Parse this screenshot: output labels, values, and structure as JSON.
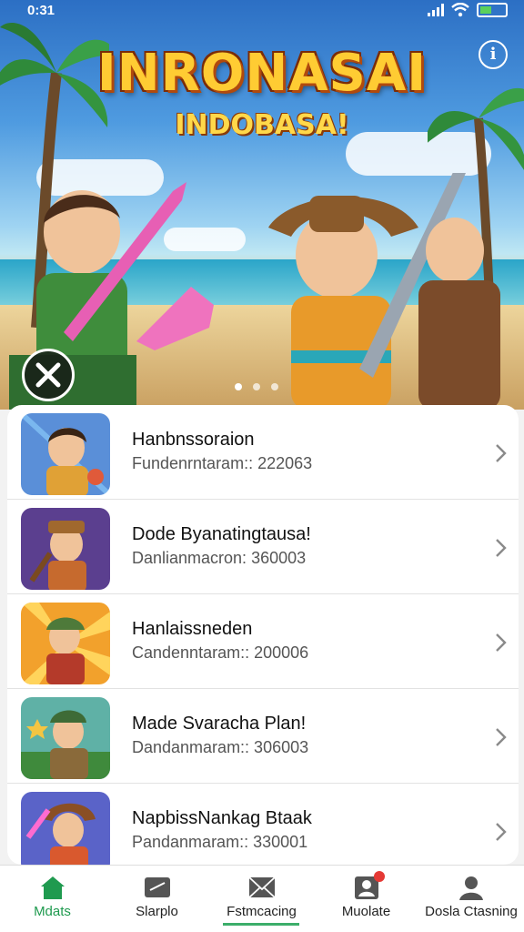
{
  "status_bar": {
    "time": "0:31"
  },
  "hero": {
    "title": "INRONASAI",
    "subtitle": "INDOBASA!"
  },
  "list": [
    {
      "title": "Hanbnssoraion",
      "subtitle": "Fundenrntaram:: 222063"
    },
    {
      "title": "Dode Byanatingtausa!",
      "subtitle": "Danlianmacron: 360003"
    },
    {
      "title": "Hanlaissneden",
      "subtitle": "Candenntaram:: 200006"
    },
    {
      "title": "Made Svaracha Plan!",
      "subtitle": "Dandanmaram:: 306003"
    },
    {
      "title": "NapbissNankag Btaak",
      "subtitle": "Pandanmaram:: 330001"
    }
  ],
  "bottom_nav": [
    {
      "label": "Mdats",
      "icon": "home-icon",
      "active": true
    },
    {
      "label": "Slarplo",
      "icon": "card-icon"
    },
    {
      "label": "Fstmcacing",
      "icon": "mail-icon"
    },
    {
      "label": "Muolate",
      "icon": "profile-card-icon"
    },
    {
      "label": "Dosla Ctasning",
      "icon": "person-icon"
    }
  ],
  "colors": {
    "accent": "#1f9a4f",
    "title": "#ffcc33",
    "badge": "#e53935"
  }
}
